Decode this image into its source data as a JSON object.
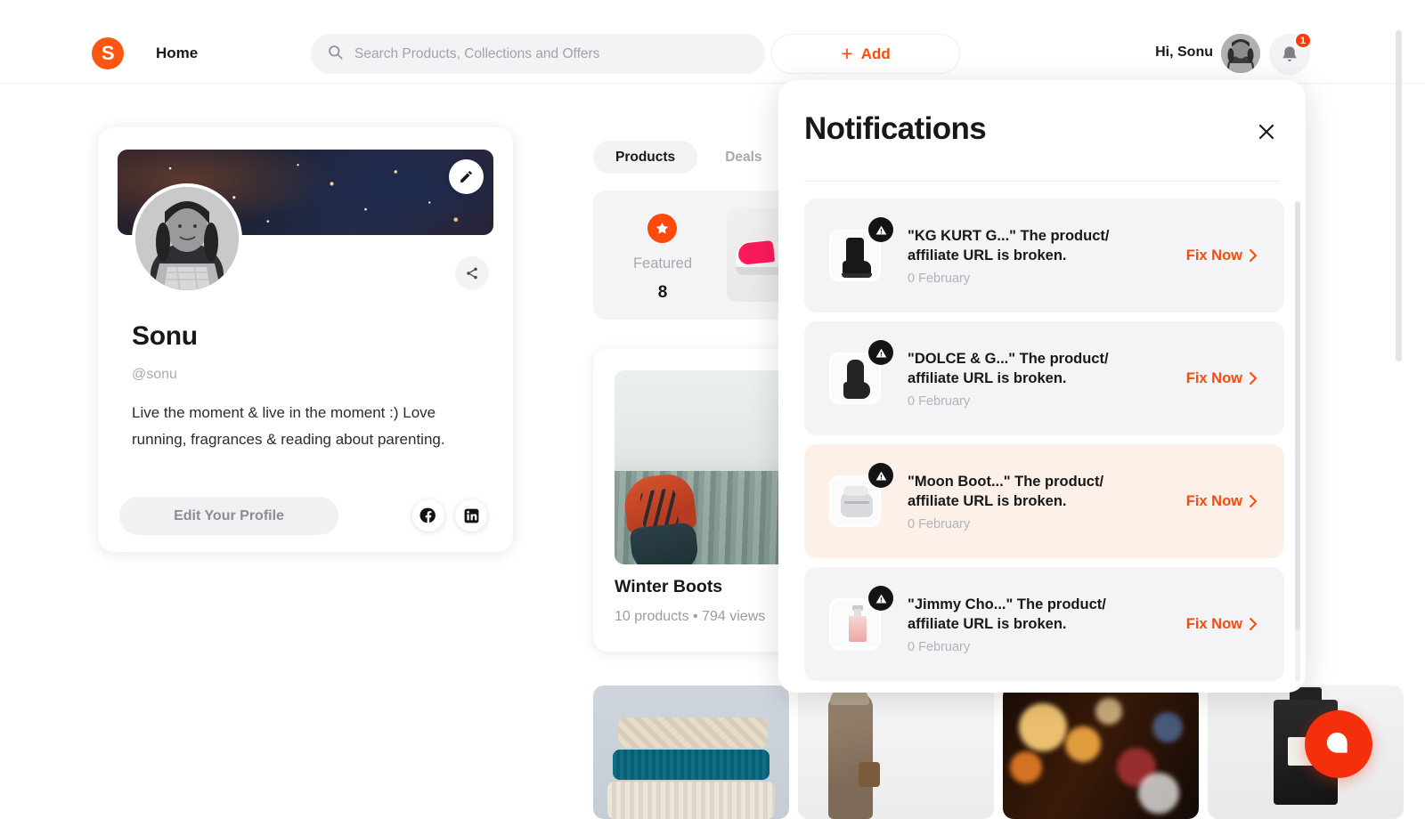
{
  "header": {
    "logo_letter": "S",
    "nav_home": "Home",
    "search": {
      "placeholder": "Search Products, Collections and Offers",
      "value": "",
      "icon": "search-icon"
    },
    "add_button": {
      "plus": "+",
      "label": "Add"
    },
    "greeting": "Hi, Sonu",
    "avatar": "user-avatar",
    "bell": {
      "icon": "bell-icon",
      "badge": "1"
    }
  },
  "profile": {
    "cover_image": "galaxy-cover",
    "edit_cover_icon": "pencil-icon",
    "share_icon": "share-icon",
    "name": "Sonu",
    "handle": "@sonu",
    "bio": "Live the moment & live in the moment :) Love running, fragrances & reading about parenting.",
    "edit_button": "Edit Your Profile",
    "socials": [
      {
        "name": "facebook-icon",
        "label": "Facebook"
      },
      {
        "name": "linkedin-icon",
        "label": "LinkedIn"
      }
    ]
  },
  "main": {
    "tabs": [
      {
        "label": "Products",
        "active": true
      },
      {
        "label": "Deals",
        "active": false
      }
    ],
    "featured": {
      "icon": "star-icon",
      "label": "Featured",
      "count": "8"
    },
    "collection": {
      "title": "Winter Boots",
      "meta": "10 products  •  794 views"
    },
    "strip_images": [
      "knitted-sweaters",
      "woman-in-coat",
      "bokeh-lights",
      "perfume-bottle"
    ]
  },
  "notifications": {
    "title": "Notifications",
    "close_icon": "close-icon",
    "fix_label": "Fix Now",
    "items": [
      {
        "product": "\"KG KURT G...\"",
        "message": "\"KG KURT G...\" The product/ affiliate URL is broken.",
        "line1": "\"KG KURT G...\" The product/",
        "line2": "affiliate URL is broken.",
        "date": "0 February",
        "thumb": "combat-boot",
        "badge_icon": "warning-icon",
        "unread": false
      },
      {
        "product": "\"DOLCE & G...\"",
        "message": "\"DOLCE & G...\" The product/ affiliate URL is broken.",
        "line1": "\"DOLCE & G...\" The product/",
        "line2": "affiliate URL is broken.",
        "date": "0 February",
        "thumb": "ugg-boot",
        "badge_icon": "warning-icon",
        "unread": false
      },
      {
        "product": "\"Moon Boot...\"",
        "message": "\"Moon Boot...\" The product/ affiliate URL is broken.",
        "line1": "\"Moon Boot...\" The product/",
        "line2": "affiliate URL is broken.",
        "date": "0 February",
        "thumb": "moon-boot",
        "badge_icon": "warning-icon",
        "unread": true
      },
      {
        "product": "\"Jimmy Cho...\"",
        "message": "\"Jimmy Cho...\" The product/ affiliate URL is broken.",
        "line1": "\"Jimmy Cho...\" The product/",
        "line2": "affiliate URL is broken.",
        "date": "0 February",
        "thumb": "perfume-bottle",
        "badge_icon": "warning-icon",
        "unread": false
      }
    ]
  },
  "chat_fab": {
    "icon": "chat-bubble-icon"
  },
  "colors": {
    "accent": "#fa4b0c",
    "accent_dark": "#f4300c",
    "text": "#17181a",
    "muted": "#a8a9b0",
    "panel_bg": "#f4f4f6",
    "unread_bg": "#fdf0e8"
  }
}
